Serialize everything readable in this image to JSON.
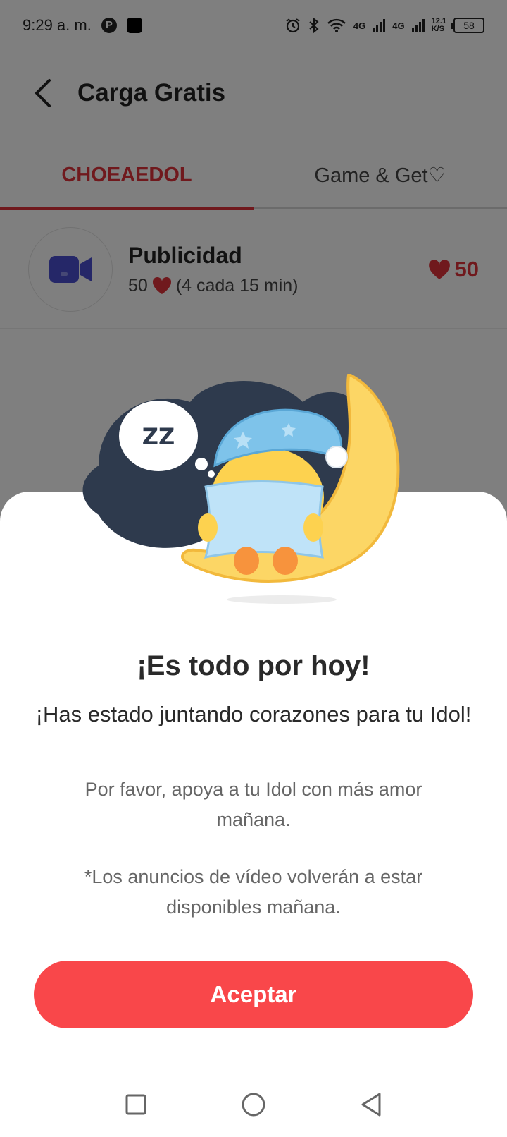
{
  "status_bar": {
    "time": "9:29 a. m.",
    "network_1": "4G",
    "network_2": "4G",
    "speed": "12.1",
    "speed_unit": "K/S",
    "battery": "58"
  },
  "header": {
    "title": "Carga Gratis"
  },
  "tabs": [
    {
      "label": "CHOEAEDOL",
      "active": true
    },
    {
      "label": "Game & Get♡",
      "active": false
    }
  ],
  "list": {
    "items": [
      {
        "title": "Publicidad",
        "subtitle_amount": "50",
        "subtitle_detail": "(4 cada 15 min)",
        "reward": "50"
      }
    ]
  },
  "dialog": {
    "title": "¡Es todo por hoy!",
    "subtitle": "¡Has estado juntando corazones para tu Idol!",
    "body": "Por favor, apoya a tu Idol con más amor mañana.",
    "note": "*Los anuncios de vídeo volverán a estar disponibles mañana.",
    "accept_label": "Aceptar",
    "bubble_text": "ZZ"
  },
  "colors": {
    "accent": "#e0323a",
    "button": "#f9474a",
    "moon": "#fcd665",
    "night": "#2e3a4d",
    "cap": "#7ec3ea"
  },
  "icons": {
    "back": "chevron-left-icon",
    "video": "video-camera-icon",
    "heart": "heart-icon",
    "nav_recent": "square-icon",
    "nav_home": "circle-icon",
    "nav_back": "triangle-back-icon"
  }
}
